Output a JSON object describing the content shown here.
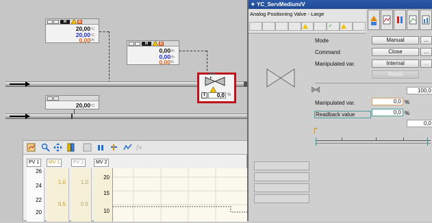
{
  "process": {
    "fp1": {
      "tag": "M",
      "alarm": "F",
      "v1": "20,00",
      "u1": "°C",
      "v2": "20,00",
      "u2": "°C",
      "v3": "0,00",
      "u3": "l/h"
    },
    "fp2": {
      "tag": "M",
      "alarm": "F",
      "v1": "0,00",
      "u1": "l/h",
      "v2": "0,00",
      "u2": "l/h",
      "v3": "0,00",
      "u3": "%"
    },
    "fp3": {
      "v1": "20,00",
      "u1": "°C"
    },
    "valve_block": {
      "mode_letter": "I",
      "value": "0,0",
      "unit": "%"
    }
  },
  "trend": {
    "tabs": [
      "PV 1",
      "MV 1",
      "PV 2",
      "MV 2"
    ],
    "axis_pv1": [
      "26",
      "24",
      "22",
      "20"
    ],
    "axis_mv1": [
      "1.0",
      "0.5"
    ],
    "axis_pv2": [
      "1.0",
      "0.5"
    ],
    "axis_mv2": [
      "20",
      "15",
      "10"
    ]
  },
  "window": {
    "title": "YC_ServMedium/V",
    "subtitle": "Analog Positioning Valve - Large",
    "mode_label": "Mode",
    "mode_value": "Manual",
    "command_label": "Command",
    "command_value": "Close",
    "manip_label": "Manipulated var.",
    "manip_value": "Internal",
    "reset_label": "Reset",
    "more": "...",
    "scale_max": "100,0",
    "manip_var_label": "Manipulated var.",
    "manip_var_value": "0,0",
    "readback_label": "Readback value",
    "readback_value": "0,0",
    "percent": "%",
    "scale_min": "0,0"
  }
}
